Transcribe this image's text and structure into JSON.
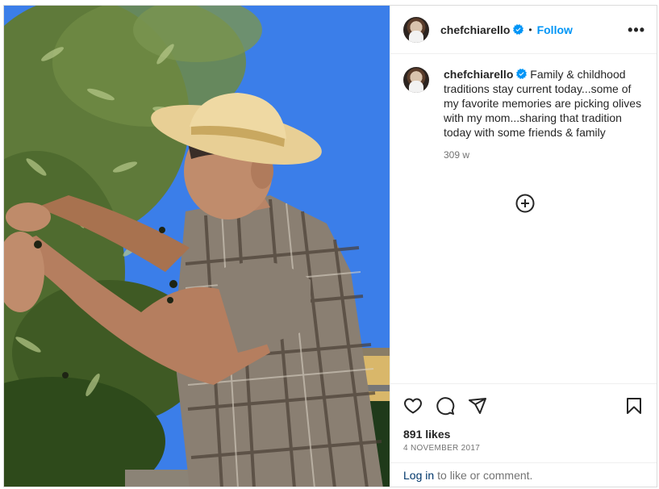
{
  "post": {
    "username": "chefchiarello",
    "follow_label": "Follow",
    "dot": "•",
    "more_label": "•••",
    "caption": "Family & childhood traditions stay current today...some of my favorite memories are picking olives with my mom...sharing that tradition today with some friends & family",
    "time_ago": "309 w",
    "likes": "891 likes",
    "date": "4 NOVEMBER 2017",
    "login_link": "Log in",
    "login_rest": "to like or comment."
  },
  "icons": {
    "verified": "verified-badge-icon",
    "add_comment": "plus-circle-icon",
    "like": "heart-icon",
    "comment": "comment-bubble-icon",
    "share": "paper-plane-icon",
    "save": "bookmark-icon",
    "more": "more-options-icon"
  },
  "colors": {
    "accent": "#0095f6",
    "link": "#00376b",
    "muted": "#737373",
    "text": "#262626",
    "verified": "#0095f6"
  }
}
